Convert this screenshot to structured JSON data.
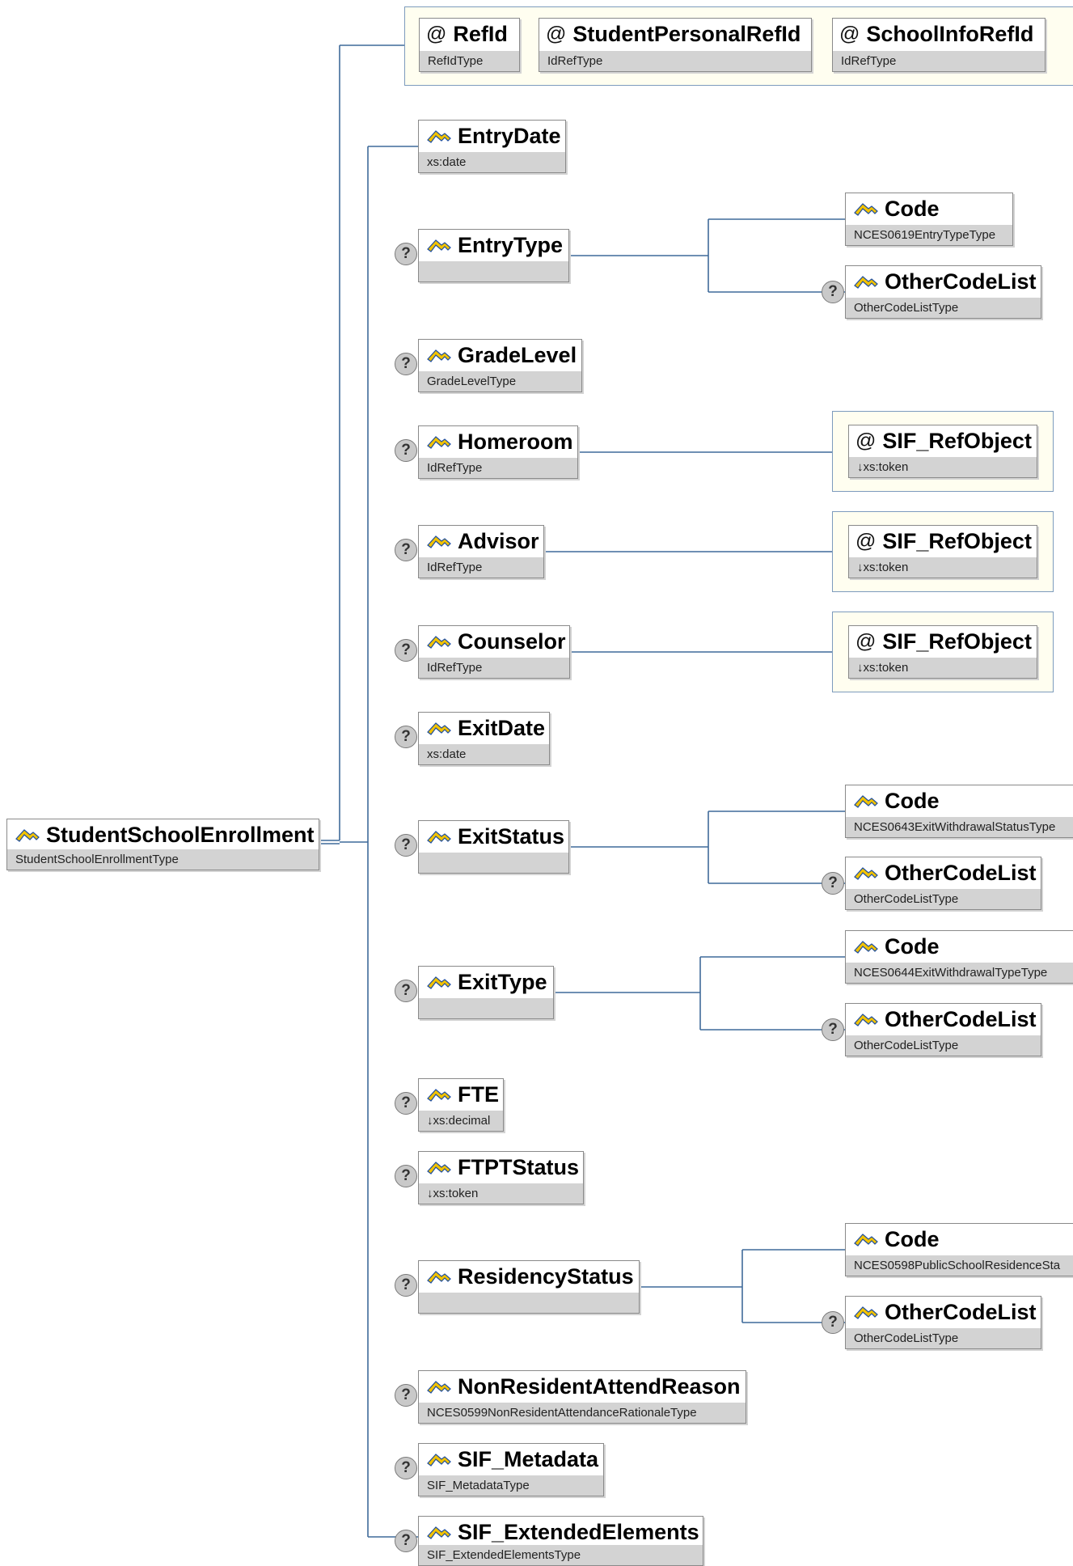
{
  "diagram": {
    "root": {
      "name": "StudentSchoolEnrollment",
      "type": "StudentSchoolEnrollmentType"
    },
    "attributes": [
      {
        "name": "RefId",
        "type": "RefIdType"
      },
      {
        "name": "StudentPersonalRefId",
        "type": "IdRefType"
      },
      {
        "name": "SchoolInfoRefId",
        "type": "IdRefType"
      }
    ],
    "children": [
      {
        "name": "EntryDate",
        "type": "xs:date",
        "optional": false
      },
      {
        "name": "EntryType",
        "type": "",
        "optional": true,
        "children": [
          {
            "name": "Code",
            "type": "NCES0619EntryTypeType",
            "optional": false
          },
          {
            "name": "OtherCodeList",
            "type": "OtherCodeListType",
            "optional": true
          }
        ]
      },
      {
        "name": "GradeLevel",
        "type": "GradeLevelType",
        "optional": true
      },
      {
        "name": "Homeroom",
        "type": "IdRefType",
        "optional": true,
        "attribute": {
          "name": "SIF_RefObject",
          "type": "↓xs:token"
        }
      },
      {
        "name": "Advisor",
        "type": "IdRefType",
        "optional": true,
        "attribute": {
          "name": "SIF_RefObject",
          "type": "↓xs:token"
        }
      },
      {
        "name": "Counselor",
        "type": "IdRefType",
        "optional": true,
        "attribute": {
          "name": "SIF_RefObject",
          "type": "↓xs:token"
        }
      },
      {
        "name": "ExitDate",
        "type": "xs:date",
        "optional": true
      },
      {
        "name": "ExitStatus",
        "type": "",
        "optional": true,
        "children": [
          {
            "name": "Code",
            "type": "NCES0643ExitWithdrawalStatusType",
            "optional": false
          },
          {
            "name": "OtherCodeList",
            "type": "OtherCodeListType",
            "optional": true
          }
        ]
      },
      {
        "name": "ExitType",
        "type": "",
        "optional": true,
        "children": [
          {
            "name": "Code",
            "type": "NCES0644ExitWithdrawalTypeType",
            "optional": false
          },
          {
            "name": "OtherCodeList",
            "type": "OtherCodeListType",
            "optional": true
          }
        ]
      },
      {
        "name": "FTE",
        "type": "↓xs:decimal",
        "optional": true
      },
      {
        "name": "FTPTStatus",
        "type": "↓xs:token",
        "optional": true
      },
      {
        "name": "ResidencyStatus",
        "type": "",
        "optional": true,
        "children": [
          {
            "name": "Code",
            "type": "NCES0598PublicSchoolResidenceSta",
            "optional": false
          },
          {
            "name": "OtherCodeList",
            "type": "OtherCodeListType",
            "optional": true
          }
        ]
      },
      {
        "name": "NonResidentAttendReason",
        "type": "NCES0599NonResidentAttendanceRationaleType",
        "optional": true
      },
      {
        "name": "SIF_Metadata",
        "type": "SIF_MetadataType",
        "optional": true
      },
      {
        "name": "SIF_ExtendedElements",
        "type": "SIF_ExtendedElementsType",
        "optional": true
      }
    ]
  },
  "icons": {
    "element": "element-icon",
    "attribute": "attribute-at-icon",
    "optional": "optional-question-icon"
  },
  "colors": {
    "connector": "#3f6a9a",
    "type_bar": "#d3d3d3",
    "attr_group_bg": "#fffef0",
    "attr_group_border": "#7d9bbd",
    "icon_yellow": "#f2c200",
    "icon_blue": "#1f4fa0"
  }
}
